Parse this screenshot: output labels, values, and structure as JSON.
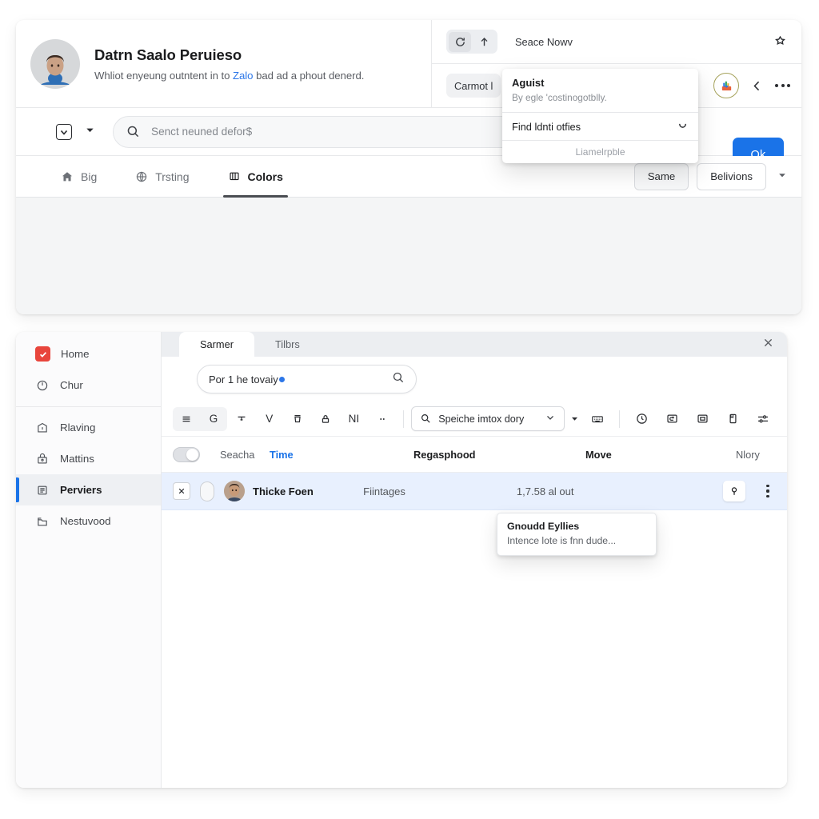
{
  "upper_panel": {
    "profile": {
      "name": "Datrn Saalo Peruieso",
      "subtitle_before": "Whliot enyeung outntent in to ",
      "subtitle_link": "Zalo",
      "subtitle_after": " bad ad a phout denerd.",
      "avatar_name": "user-avatar"
    },
    "top_bar": {
      "refresh_icon": "refresh-icon",
      "up_icon": "arrow-up-icon",
      "label": "Seace Nowv",
      "star_icon": "star-bookmark-icon"
    },
    "second_bar": {
      "pill_label": "Carmot l",
      "avatar_badge": "profile-badge-icon",
      "back_icon": "chevron-left-icon",
      "more_icon": "more-horizontal-icon"
    },
    "search": {
      "checkbox_icon": "checkbox-icon",
      "caret_icon": "chevron-down-icon",
      "search_icon": "search-icon",
      "placeholder": "Senct neuned defor$",
      "value": ""
    },
    "ok_button": "Ok",
    "tabs": [
      {
        "label": "Big",
        "icon": "home-icon",
        "active": false
      },
      {
        "label": "Trsting",
        "icon": "globe-icon",
        "active": false
      },
      {
        "label": "Colors",
        "icon": "palette-icon",
        "active": true
      }
    ],
    "tab_actions": {
      "primary": "Same",
      "secondary": "Belivions",
      "caret_icon": "chevron-down-icon"
    }
  },
  "popup": {
    "title": "Aguist",
    "description": "By egle 'costinogotblly.",
    "field_value": "Find ldnti otfies",
    "field_chev_icon": "chevron-down-icon",
    "footer": "Liamelrpble"
  },
  "lower_panel": {
    "sidebar": [
      {
        "label": "Home",
        "icon": "checkbox-red-icon",
        "active": false
      },
      {
        "label": "Chur",
        "icon": "clock-icon",
        "active": false
      },
      {
        "label": "Rlaving",
        "icon": "archive-icon",
        "active": false
      },
      {
        "label": "Mattins",
        "icon": "inbox-icon",
        "active": false
      },
      {
        "label": "Perviers",
        "icon": "list-icon",
        "active": true
      },
      {
        "label": "Nestuvood",
        "icon": "folder-icon",
        "active": false
      }
    ],
    "tabs": [
      {
        "label": "Sarmer",
        "active": true
      },
      {
        "label": "Tilbrs",
        "active": false
      }
    ],
    "close_icon": "close-icon",
    "search": {
      "value": "Por 1 he tovaiy",
      "search_icon": "search-icon"
    },
    "toolbar": {
      "group": [
        "menu-icon",
        "G"
      ],
      "items": [
        "filter-icon",
        "V",
        "crop-icon",
        "lock-icon",
        "NI",
        "more-horizontal-icon"
      ],
      "select_value": "Speiche imtox dory",
      "select_search_icon": "search-icon",
      "select_chev_icon": "chevron-down-icon",
      "after_caret_icon": "caret-down-icon",
      "keyboard_icon": "keyboard-icon",
      "right_icons": [
        "clock-info-icon",
        "rotate-icon",
        "archive-box-icon",
        "book-icon",
        "sliders-icon"
      ]
    },
    "table": {
      "toggle_name": "select-all-toggle",
      "columns": [
        {
          "label": "Seacha",
          "style": "muted"
        },
        {
          "label": "Time",
          "style": "blue"
        },
        {
          "label": "Regasphood",
          "style": "bold"
        },
        {
          "label": "Move",
          "style": "bold"
        },
        {
          "label": "Nlory",
          "style": "muted"
        }
      ],
      "rows": [
        {
          "close_icon": "close-icon",
          "name": "Thicke Foen",
          "col2": "Fiintages",
          "col3": "1,7.58 al out",
          "pin_icon": "pin-icon",
          "menu_icon": "more-vertical-icon"
        }
      ]
    }
  },
  "tooltip": {
    "title": "Gnoudd Eyllies",
    "body": "Intence lote is fnn dude..."
  },
  "colors": {
    "accent_blue": "#1a73e8",
    "link_blue": "#2d77e8",
    "row_highlight": "#e8f0fe",
    "red_badge": "#e8453c",
    "panel_bg": "#f4f5f6"
  }
}
